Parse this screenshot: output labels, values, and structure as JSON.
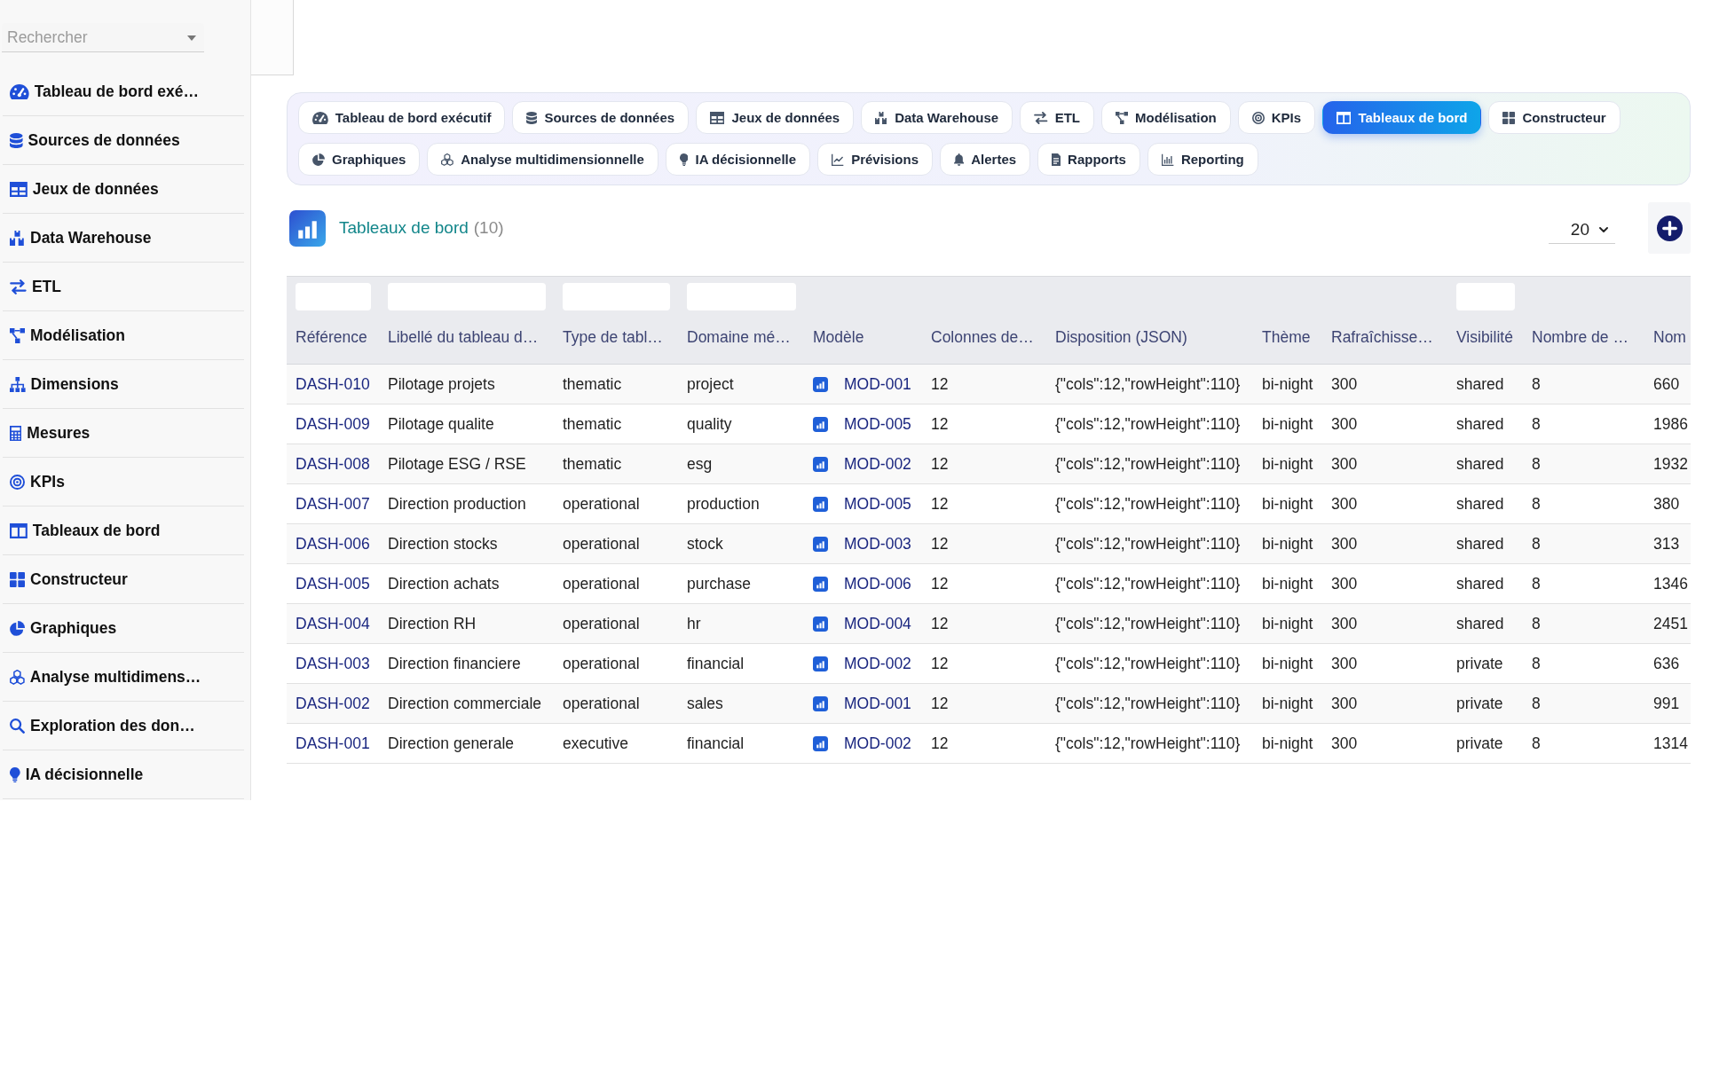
{
  "search": {
    "placeholder": "Rechercher"
  },
  "sidebar": {
    "items": [
      {
        "label": "Tableau de bord exé…"
      },
      {
        "label": "Sources de données"
      },
      {
        "label": "Jeux de données"
      },
      {
        "label": "Data Warehouse"
      },
      {
        "label": "ETL"
      },
      {
        "label": "Modélisation"
      },
      {
        "label": "Dimensions"
      },
      {
        "label": "Mesures"
      },
      {
        "label": "KPIs"
      },
      {
        "label": "Tableaux de bord"
      },
      {
        "label": "Constructeur"
      },
      {
        "label": "Graphiques"
      },
      {
        "label": "Analyse multidimens…"
      },
      {
        "label": "Exploration des don…"
      },
      {
        "label": "IA décisionnelle"
      }
    ]
  },
  "tabs": [
    {
      "label": "Tableau de bord exécutif",
      "selected": false
    },
    {
      "label": "Sources de données",
      "selected": false
    },
    {
      "label": "Jeux de données",
      "selected": false
    },
    {
      "label": "Data Warehouse",
      "selected": false
    },
    {
      "label": "ETL",
      "selected": false
    },
    {
      "label": "Modélisation",
      "selected": false
    },
    {
      "label": "KPIs",
      "selected": false
    },
    {
      "label": "Tableaux de bord",
      "selected": true
    },
    {
      "label": "Constructeur",
      "selected": false
    },
    {
      "label": "Graphiques",
      "selected": false
    },
    {
      "label": "Analyse multidimensionnelle",
      "selected": false
    },
    {
      "label": "IA décisionnelle",
      "selected": false
    },
    {
      "label": "Prévisions",
      "selected": false
    },
    {
      "label": "Alertes",
      "selected": false
    },
    {
      "label": "Rapports",
      "selected": false
    },
    {
      "label": "Reporting",
      "selected": false
    }
  ],
  "page_header": {
    "title": "Tableaux de bord",
    "count": "(10)",
    "page_size": "20"
  },
  "table": {
    "columns": [
      {
        "label": "Référence",
        "filter": true,
        "kind": "link"
      },
      {
        "label": "Libellé du tableau d…",
        "filter": true,
        "kind": "text"
      },
      {
        "label": "Type de tabl…",
        "filter": true,
        "kind": "text"
      },
      {
        "label": "Domaine mé…",
        "filter": true,
        "kind": "text"
      },
      {
        "label": "Modèle",
        "filter": false,
        "kind": "model"
      },
      {
        "label": "Colonnes de…",
        "filter": false,
        "kind": "text"
      },
      {
        "label": "Disposition (JSON)",
        "filter": false,
        "kind": "text"
      },
      {
        "label": "Thème",
        "filter": false,
        "kind": "text"
      },
      {
        "label": "Rafraîchisse…",
        "filter": false,
        "kind": "text"
      },
      {
        "label": "Visibilité",
        "filter": true,
        "kind": "text"
      },
      {
        "label": "Nombre de …",
        "filter": false,
        "kind": "text"
      },
      {
        "label": "Nom",
        "filter": false,
        "kind": "text"
      }
    ],
    "rows": [
      {
        "cells": [
          "DASH-010",
          "Pilotage projets",
          "thematic",
          "project",
          "MOD-001",
          "12",
          "{\"cols\":12,\"rowHeight\":110}",
          "bi-night",
          "300",
          "shared",
          "8",
          "660"
        ]
      },
      {
        "cells": [
          "DASH-009",
          "Pilotage qualite",
          "thematic",
          "quality",
          "MOD-005",
          "12",
          "{\"cols\":12,\"rowHeight\":110}",
          "bi-night",
          "300",
          "shared",
          "8",
          "1986"
        ]
      },
      {
        "cells": [
          "DASH-008",
          "Pilotage ESG / RSE",
          "thematic",
          "esg",
          "MOD-002",
          "12",
          "{\"cols\":12,\"rowHeight\":110}",
          "bi-night",
          "300",
          "shared",
          "8",
          "1932"
        ]
      },
      {
        "cells": [
          "DASH-007",
          "Direction production",
          "operational",
          "production",
          "MOD-005",
          "12",
          "{\"cols\":12,\"rowHeight\":110}",
          "bi-night",
          "300",
          "shared",
          "8",
          "380"
        ]
      },
      {
        "cells": [
          "DASH-006",
          "Direction stocks",
          "operational",
          "stock",
          "MOD-003",
          "12",
          "{\"cols\":12,\"rowHeight\":110}",
          "bi-night",
          "300",
          "shared",
          "8",
          "313"
        ]
      },
      {
        "cells": [
          "DASH-005",
          "Direction achats",
          "operational",
          "purchase",
          "MOD-006",
          "12",
          "{\"cols\":12,\"rowHeight\":110}",
          "bi-night",
          "300",
          "shared",
          "8",
          "1346"
        ]
      },
      {
        "cells": [
          "DASH-004",
          "Direction RH",
          "operational",
          "hr",
          "MOD-004",
          "12",
          "{\"cols\":12,\"rowHeight\":110}",
          "bi-night",
          "300",
          "shared",
          "8",
          "2451"
        ]
      },
      {
        "cells": [
          "DASH-003",
          "Direction financiere",
          "operational",
          "financial",
          "MOD-002",
          "12",
          "{\"cols\":12,\"rowHeight\":110}",
          "bi-night",
          "300",
          "private",
          "8",
          "636"
        ]
      },
      {
        "cells": [
          "DASH-002",
          "Direction commerciale",
          "operational",
          "sales",
          "MOD-001",
          "12",
          "{\"cols\":12,\"rowHeight\":110}",
          "bi-night",
          "300",
          "private",
          "8",
          "991"
        ]
      },
      {
        "cells": [
          "DASH-001",
          "Direction generale",
          "executive",
          "financial",
          "MOD-002",
          "12",
          "{\"cols\":12,\"rowHeight\":110}",
          "bi-night",
          "300",
          "private",
          "8",
          "1314"
        ]
      }
    ]
  }
}
